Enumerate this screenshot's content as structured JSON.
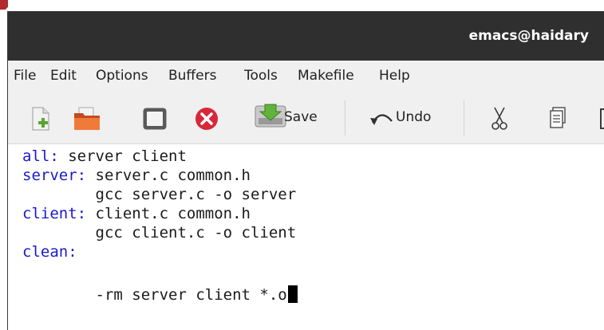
{
  "window": {
    "title": "emacs@haidary"
  },
  "menu": [
    "File",
    "Edit",
    "Options",
    "Buffers",
    "Tools",
    "Makefile",
    "Help"
  ],
  "toolbar": {
    "new_icon": "new-file-icon",
    "open_icon": "open-folder-icon",
    "dired_icon": "window-icon",
    "close_icon": "close-icon",
    "save_label": "Save",
    "undo_label": "Undo",
    "cut_icon": "scissors-icon",
    "copy_icon": "copy-icon"
  },
  "code": [
    {
      "target": "all:",
      "rest": " server client"
    },
    {
      "target": "server:",
      "rest": " server.c common.h"
    },
    {
      "target": "",
      "rest": "        gcc server.c -o server"
    },
    {
      "target": "client:",
      "rest": " client.c common.h"
    },
    {
      "target": "",
      "rest": "        gcc client.c -o client"
    },
    {
      "target": "clean:",
      "rest": ""
    },
    {
      "target": "",
      "rest": "        -rm server client *.o"
    }
  ],
  "colors": {
    "titlebar": "#2f2f2f",
    "menubar": "#f0f0f0",
    "target": "#1a1acc",
    "close_red": "#d7283a"
  }
}
